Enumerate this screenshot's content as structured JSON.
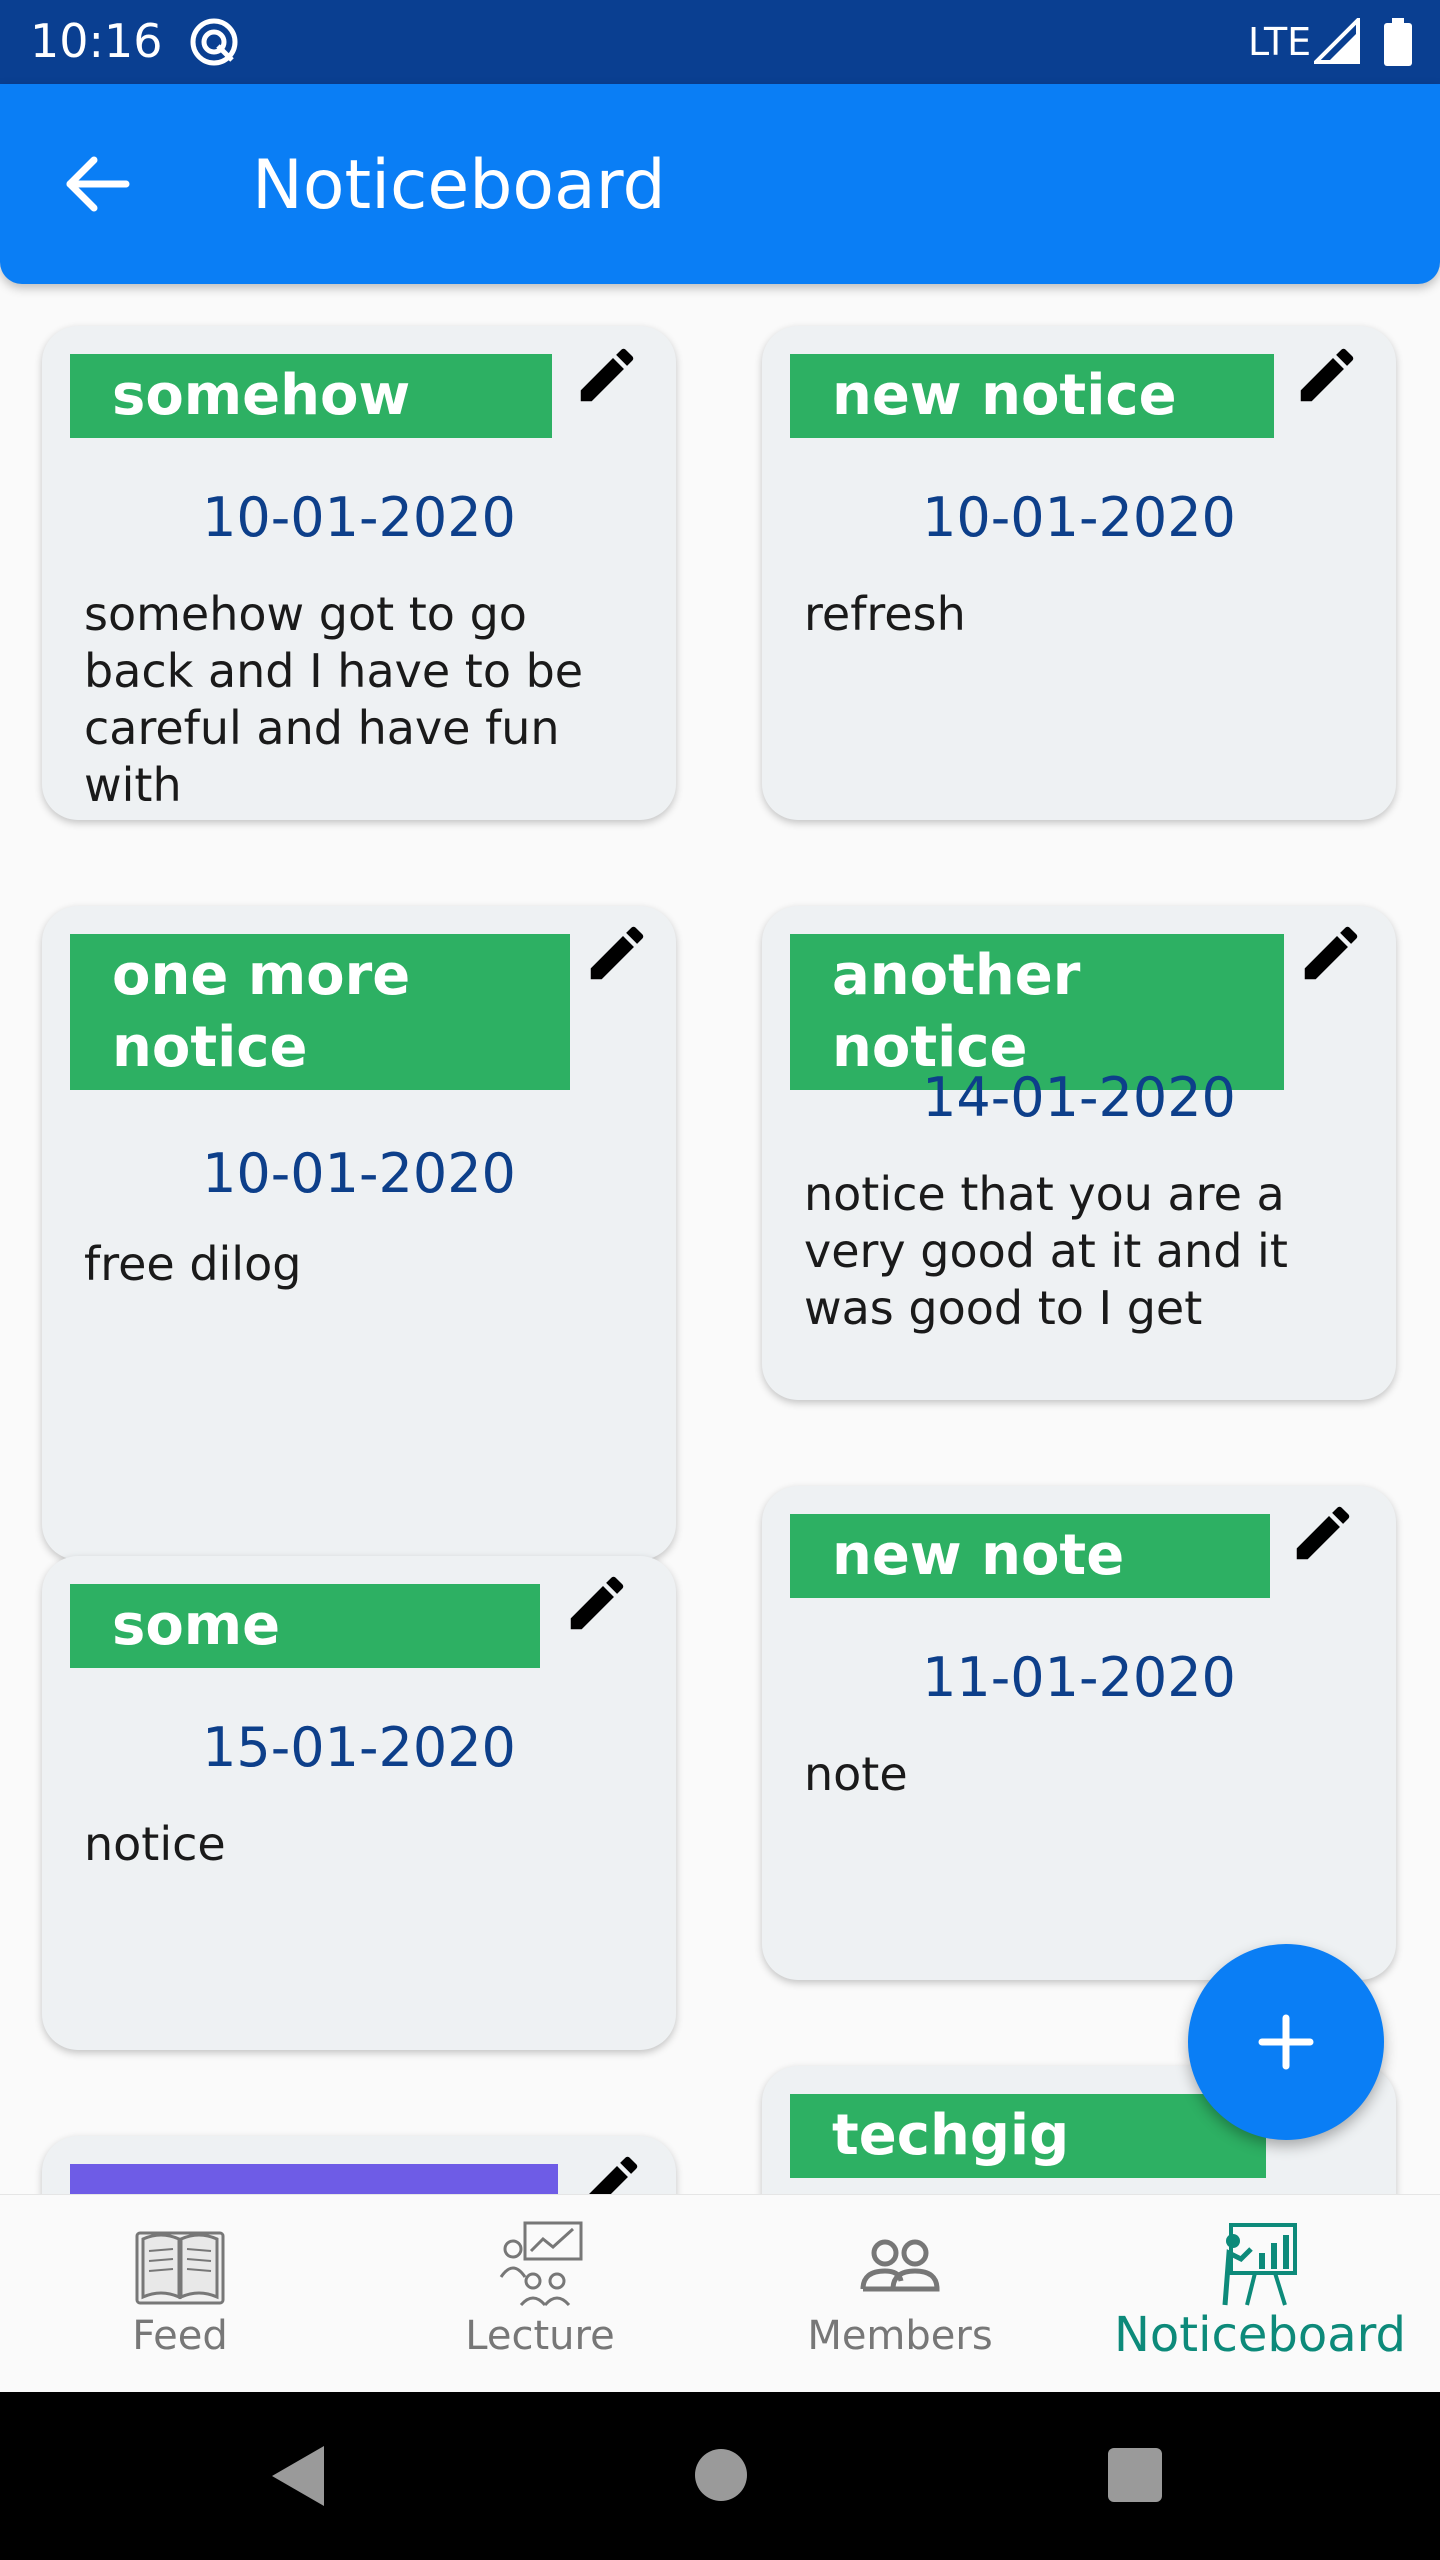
{
  "status_bar": {
    "time": "10:16",
    "network": "LTE"
  },
  "app_bar": {
    "title": "Noticeboard"
  },
  "notices": [
    {
      "title": "somehow",
      "date": "10-01-2020",
      "body": "somehow got to go back and I have to be careful and have fun with"
    },
    {
      "title": "new notice",
      "date": "10-01-2020",
      "body": "refresh"
    },
    {
      "title": "one more notice",
      "date": "10-01-2020",
      "body": "free dilog"
    },
    {
      "title": "another notice",
      "date": "14-01-2020",
      "body": "notice that you are a very good at it and it was good to  I get"
    },
    {
      "title": "some",
      "date": "15-01-2020",
      "body": "notice"
    },
    {
      "title": "new note",
      "date": "11-01-2020",
      "body": "note"
    },
    {
      "title": "techgig"
    }
  ],
  "fab": {
    "icon": "plus-icon"
  },
  "bottom_nav": {
    "items": [
      {
        "label": "Feed",
        "icon": "book-icon"
      },
      {
        "label": "Lecture",
        "icon": "lecture-icon"
      },
      {
        "label": "Members",
        "icon": "members-icon"
      },
      {
        "label": "Noticeboard",
        "icon": "noticeboard-icon",
        "active": true
      }
    ]
  },
  "colors": {
    "status_bar": "#0a3f91",
    "app_bar": "#0a7ef5",
    "title_tag_green": "#2db063",
    "title_tag_purple": "#6e5ce6",
    "date_text": "#0d3f8a",
    "active_nav": "#0d8a7a"
  }
}
